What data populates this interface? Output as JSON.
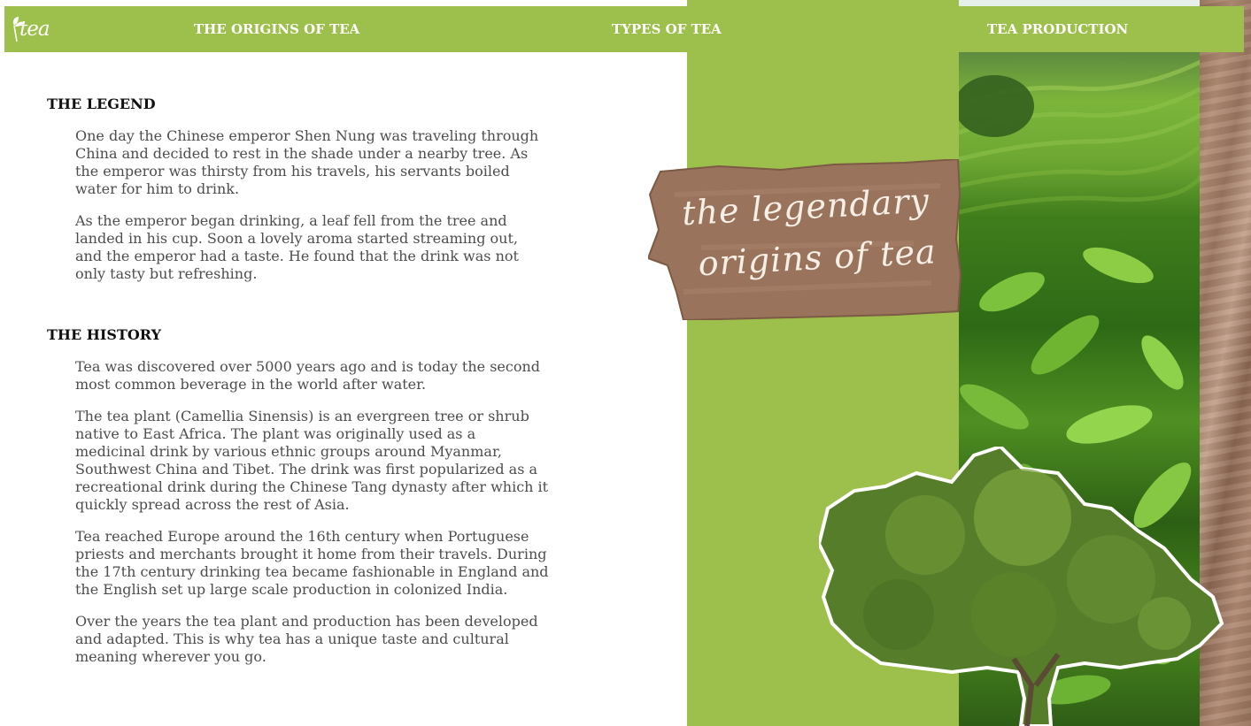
{
  "nav": {
    "logo_text": "tea",
    "links": [
      "THE ORIGINS OF TEA",
      "TYPES OF TEA",
      "TEA PRODUCTION"
    ]
  },
  "legend": {
    "heading": "THE LEGEND",
    "paragraphs": [
      "One day the Chinese emperor Shen Nung was traveling through China and decided to rest in the shade under a nearby tree. As the emperor was thirsty from his travels, his servants boiled water for him to drink.",
      "As the emperor began drinking, a leaf fell from the tree and landed in his cup. Soon a lovely aroma started streaming out, and the emperor had a taste. He found that the drink was not only tasty but refreshing."
    ]
  },
  "history": {
    "heading": "THE HISTORY",
    "paragraphs": [
      "Tea was discovered over 5000 years ago and is today the second most common beverage in the world after water.",
      "The tea plant (Camellia Sinensis) is an evergreen tree or shrub native to East Africa. The plant was originally used as a medicinal drink by various ethnic groups around Myanmar, Southwest China and Tibet. The drink was first popularized as a recreational drink during the Chinese Tang dynasty after which it quickly spread across the rest of Asia.",
      "Tea reached Europe around the 16th century when Portuguese priests and merchants brought it home from their travels. During the 17th century drinking tea became fashionable in England and the English set up large scale production in colonized India.",
      "Over the years the tea plant and production has been developed and adapted. This is why tea has a unique taste and cultural meaning wherever you go."
    ]
  },
  "hero": {
    "label_line1": "the legendary",
    "label_line2": "origins of tea"
  },
  "colors": {
    "accent_green": "#9dbf4c",
    "heading": "#111111",
    "body_text": "#4d4d4d",
    "kraft_paper": "#9a735c"
  }
}
